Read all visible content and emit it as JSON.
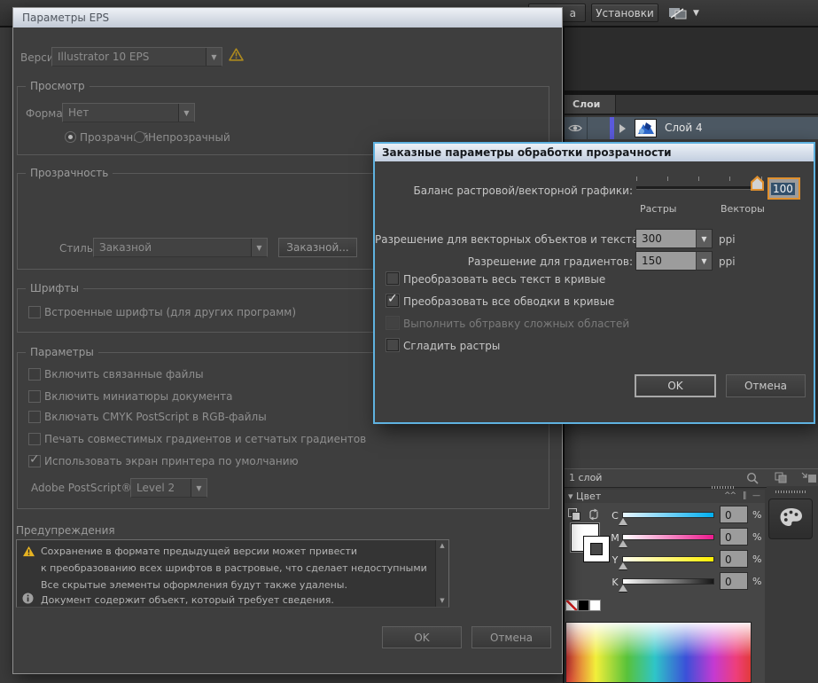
{
  "app": {
    "top_bar": {
      "partial_label": "а",
      "presets_label": "Установки"
    },
    "layers_panel": {
      "tab": "Слои",
      "layer_name": "Слой 4",
      "status": "1 слой"
    },
    "color_panel": {
      "tab": "Цвет",
      "rows": [
        {
          "ch": "C",
          "val": "0",
          "unit": "%"
        },
        {
          "ch": "M",
          "val": "0",
          "unit": "%"
        },
        {
          "ch": "Y",
          "val": "0",
          "unit": "%"
        },
        {
          "ch": "K",
          "val": "0",
          "unit": "%"
        }
      ]
    }
  },
  "eps": {
    "title": "Параметры EPS",
    "version_label": "Версия:",
    "version_value": "Illustrator 10 EPS",
    "preview": {
      "legend": "Просмотр",
      "format_label": "Формат:",
      "format_value": "Нет",
      "radio_transparent": "Прозрачный",
      "radio_opaque": "Непрозрачный",
      "transparent_selected": true
    },
    "transparency": {
      "legend": "Прозрачность",
      "style_label": "Стиль:",
      "style_value": "Заказной",
      "custom_button": "Заказной..."
    },
    "fonts": {
      "legend": "Шрифты",
      "embed_label": "Встроенные шрифты (для других программ)",
      "embed_checked": false
    },
    "options": {
      "legend": "Параметры",
      "items": [
        {
          "label": "Включить связанные файлы",
          "checked": false
        },
        {
          "label": "Включить миниатюры документа",
          "checked": false
        },
        {
          "label": "Включать CMYK PostScript в RGB-файлы",
          "checked": false
        },
        {
          "label": "Печать совместимых градиентов и сетчатых градиентов",
          "checked": false
        },
        {
          "label": "Использовать экран принтера по умолчанию",
          "checked": true
        }
      ],
      "postscript_label": "Adobe PostScript®:",
      "postscript_value": "Level 2"
    },
    "warnings": {
      "legend": "Предупреждения",
      "lines": [
        {
          "icon": "warning",
          "text": "Сохранение в формате предыдущей версии может привести"
        },
        {
          "icon": "none",
          "text": "к преобразованию всех шрифтов в растровые, что сделает недоступными"
        },
        {
          "icon": "none",
          "text": "Все скрытые элементы оформления будут также удалены."
        },
        {
          "icon": "info",
          "text": "Документ содержит объект, который требует сведения."
        }
      ]
    },
    "ok": "OK",
    "cancel": "Отмена"
  },
  "flattener": {
    "title": "Заказные параметры обработки прозрачности",
    "balance_label": "Баланс растровой/векторной графики:",
    "balance_value": "100",
    "raster_label": "Растры",
    "vector_label": "Векторы",
    "res_text_label": "Разрешение для векторных объектов и текста:",
    "res_text_value": "300",
    "res_gradient_label": "Разрешение для градиентов:",
    "res_gradient_value": "150",
    "unit": "ppi",
    "items": [
      {
        "label": "Преобразовать весь текст в кривые",
        "checked": false,
        "disabled": false
      },
      {
        "label": "Преобразовать все обводки в кривые",
        "checked": true,
        "disabled": false
      },
      {
        "label": "Выполнить обтравку сложных областей",
        "checked": false,
        "disabled": true
      },
      {
        "label": "Сгладить растры",
        "checked": false,
        "disabled": false
      }
    ],
    "ok": "OK",
    "cancel": "Отмена"
  },
  "colors": {
    "modal_focus_border": "#5fb2e0",
    "focus_ring_orange": "#e0902e",
    "text_selection_bg": "#33506b",
    "warning_amber": "#e6b322",
    "layer_row_selection": "#4d5964",
    "layer_color_strip": "#5b5bdd",
    "cyan": "#00aeef",
    "magenta": "#ec1a8d",
    "yellow": "#ffef00"
  }
}
